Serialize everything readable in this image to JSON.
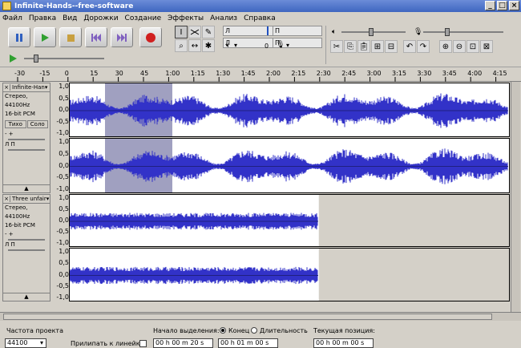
{
  "window": {
    "title": "Infinite-Hands--free-software",
    "buttons": [
      "_",
      "□",
      "×"
    ]
  },
  "menu": [
    "Файл",
    "Правка",
    "Вид",
    "Дорожки",
    "Создание",
    "Эффекты",
    "Анализ",
    "Справка"
  ],
  "meter": {
    "left_label": "Л",
    "right_label": "П",
    "zero": "0"
  },
  "ruler_ticks": [
    "-30",
    "-15",
    "0",
    "15",
    "30",
    "45",
    "1:00",
    "1:15",
    "1:30",
    "1:45",
    "2:00",
    "2:15",
    "2:30",
    "2:45",
    "3:00",
    "3:15",
    "3:30",
    "3:45",
    "4:00",
    "4:15"
  ],
  "amplitude_labels": [
    "1,0",
    "0,5",
    "0,0",
    "-0,5",
    "-1,0"
  ],
  "tracks": [
    {
      "name": "Infinite-Han",
      "format": "Стерео, 44100Hz",
      "bits": "16-bit PCM",
      "mute": "Тихо",
      "solo": "Соло",
      "gain": "- +",
      "pan": "Л П",
      "collapse": "▲"
    },
    {
      "name": "Three unfair",
      "format": "Стерео, 44100Hz",
      "bits": "16-bit PCM",
      "gain": "- +",
      "pan": "Л П",
      "collapse": "▲"
    }
  ],
  "statusbar": {
    "rate_label": "Частота проекта",
    "rate_value": "44100",
    "snap_label": "Прилипать к линейке",
    "selection_label": "Начало выделения:",
    "end_label": "Конец",
    "length_label": "Длительность",
    "position_label": "Текущая позиция:",
    "sel_start": "00 h 00 m 20 s",
    "sel_end": "00 h 01 m 00 s",
    "position": "00 h 00 m 00 s"
  },
  "colors": {
    "wave": "#3232c8",
    "selection": "#a0a0c0",
    "titlebar": "#4a6fc8"
  }
}
